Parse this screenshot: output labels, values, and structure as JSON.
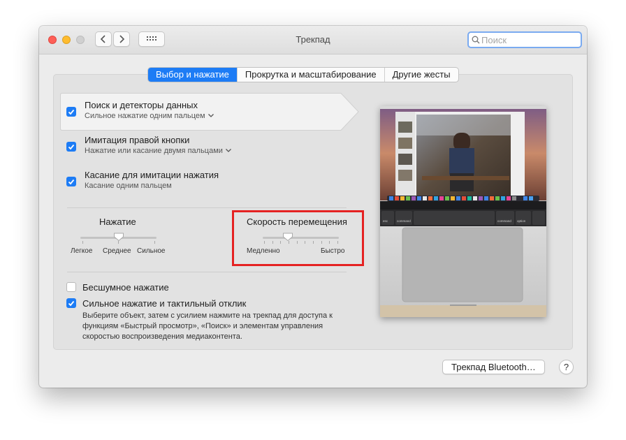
{
  "window": {
    "title": "Трекпад",
    "search_placeholder": "Поиск"
  },
  "tabs": [
    {
      "label": "Выбор и нажатие",
      "active": true
    },
    {
      "label": "Прокрутка и масштабирование",
      "active": false
    },
    {
      "label": "Другие жесты",
      "active": false
    }
  ],
  "options": [
    {
      "title": "Поиск и детекторы данных",
      "subtitle": "Сильное нажатие одним пальцем",
      "checked": true,
      "has_dropdown": true
    },
    {
      "title": "Имитация правой кнопки",
      "subtitle": "Нажатие или касание двумя пальцами",
      "checked": true,
      "has_dropdown": true
    },
    {
      "title": "Касание для имитации нажатия",
      "subtitle": "Касание одним пальцем",
      "checked": true,
      "has_dropdown": false
    }
  ],
  "click_slider": {
    "label": "Нажатие",
    "ticks": [
      "Легкое",
      "Среднее",
      "Сильное"
    ],
    "selected_index": 1
  },
  "speed_slider": {
    "label": "Скорость перемещения",
    "min_label": "Медленно",
    "max_label": "Быстро",
    "value_fraction": 0.33
  },
  "bottom_options": [
    {
      "title": "Бесшумное нажатие",
      "checked": false
    },
    {
      "title": "Сильное нажатие и тактильный отклик",
      "checked": true
    }
  ],
  "force_click_description": "Выберите объект, затем с усилием нажмите на трекпад для доступа к функциям «Быстрый просмотр», «Поиск» и элементам управления скоростью воспроизведения медиаконтента.",
  "preview": {
    "touchbar_keys": [
      "esc",
      "command",
      "command",
      "option"
    ]
  },
  "buttons": {
    "bluetooth": "Трекпад Bluetooth…",
    "help": "?"
  },
  "colors": {
    "accent": "#1d7cf5",
    "highlight_box": "#e52222"
  }
}
